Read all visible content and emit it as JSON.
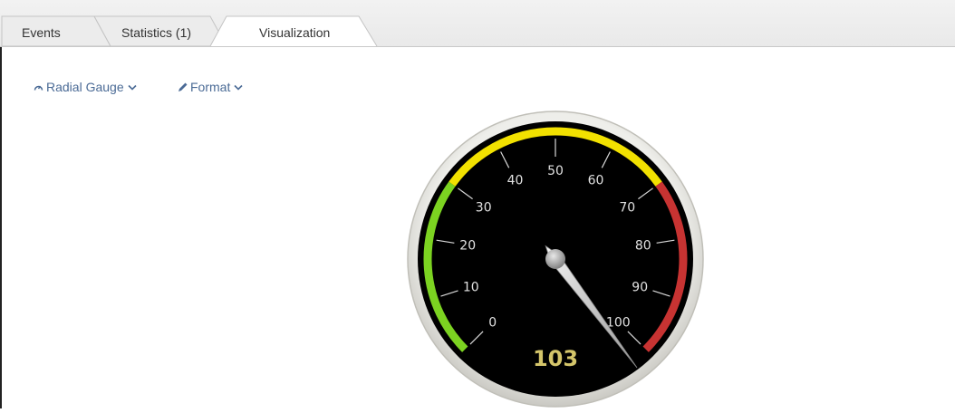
{
  "tabs": [
    {
      "label": "Events",
      "active": false
    },
    {
      "label": "Statistics (1)",
      "active": false
    },
    {
      "label": "Visualization",
      "active": true
    }
  ],
  "toolbar": {
    "viz_type_label": "Radial Gauge",
    "format_label": "Format"
  },
  "gauge": {
    "value": 103,
    "value_display": "103",
    "min": 0,
    "max": 100,
    "ticks": [
      "0",
      "10",
      "20",
      "30",
      "40",
      "50",
      "60",
      "70",
      "80",
      "90",
      "100"
    ],
    "ranges": [
      {
        "from": 0,
        "to": 30,
        "color": "#7cd321"
      },
      {
        "from": 30,
        "to": 70,
        "color": "#f2e100"
      },
      {
        "from": 70,
        "to": 100,
        "color": "#c73332"
      }
    ],
    "value_color": "#d4c56a",
    "face_color": "#000000"
  },
  "colors": {
    "link": "#4b6b96",
    "tab_text": "#333333"
  }
}
